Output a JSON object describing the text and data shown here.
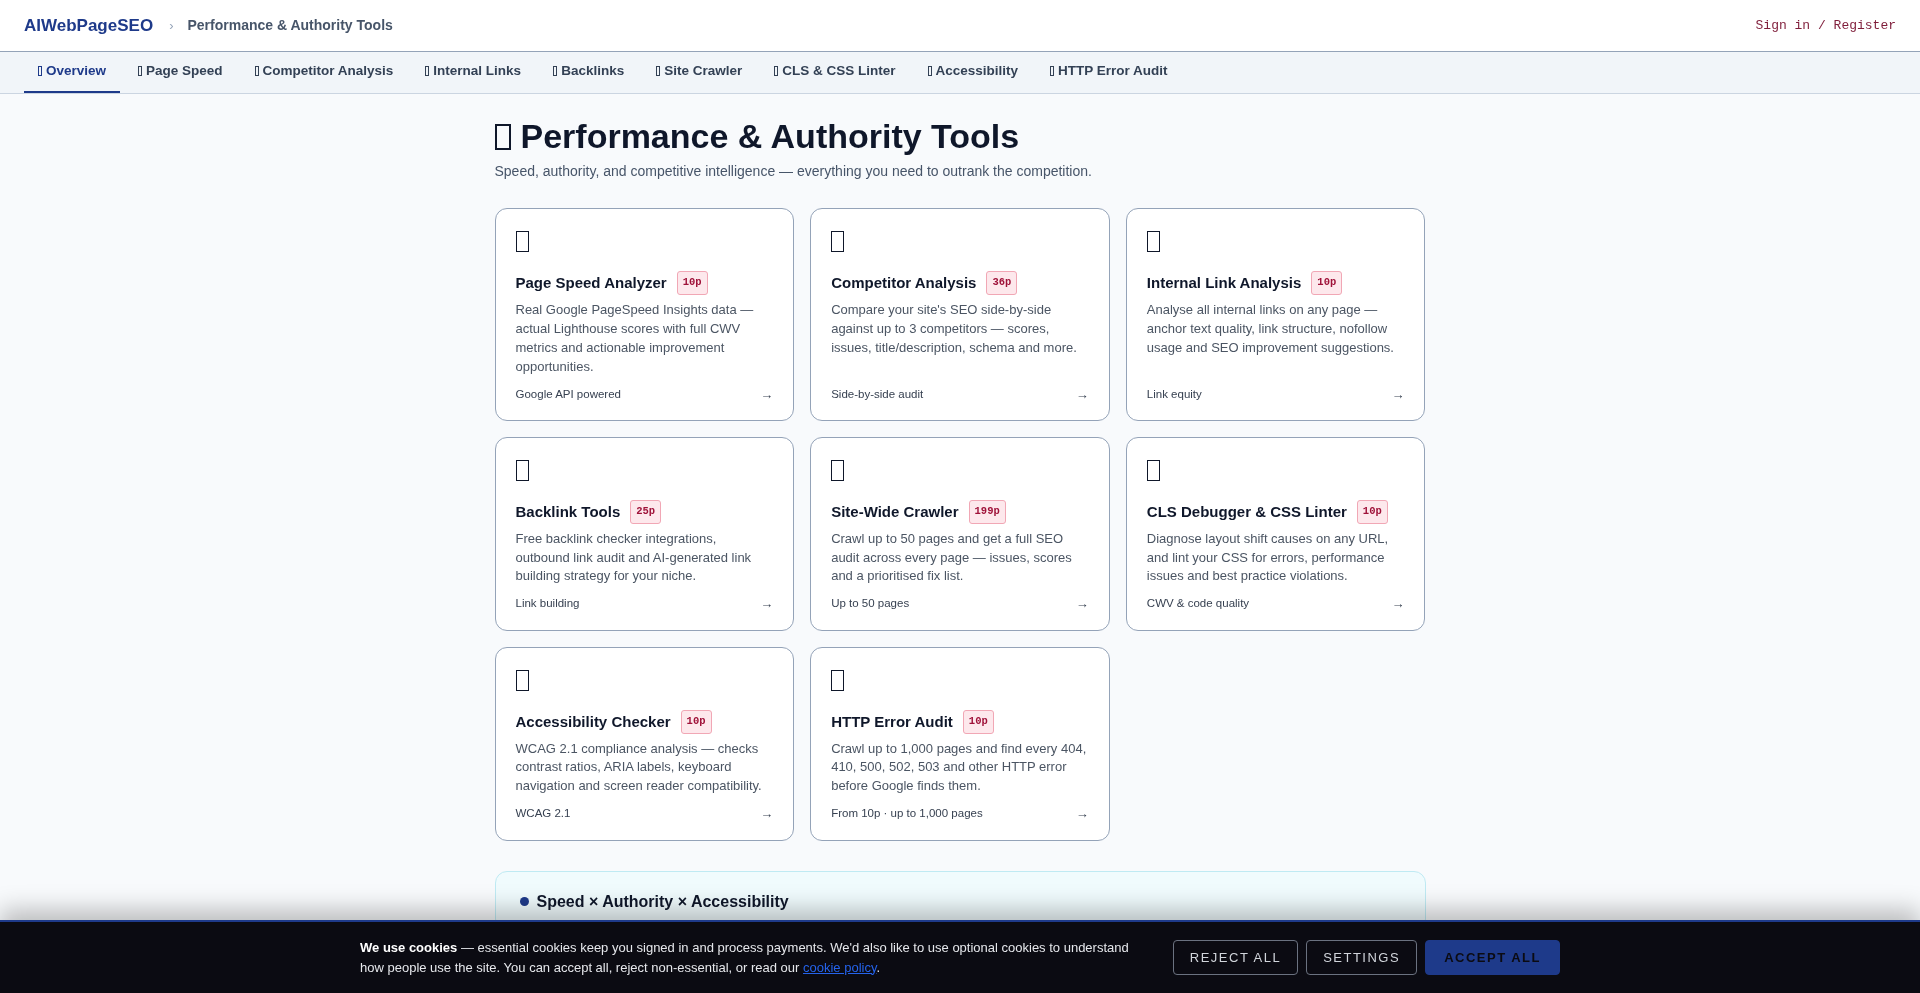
{
  "header": {
    "logo": "AIWebPageSEO",
    "separator": "›",
    "breadcrumb": "Performance & Authority Tools",
    "sign_in": "Sign in / Register"
  },
  "tabs": [
    {
      "label": "Overview",
      "selected": true
    },
    {
      "label": "Page Speed",
      "selected": false
    },
    {
      "label": "Competitor Analysis",
      "selected": false
    },
    {
      "label": "Internal Links",
      "selected": false
    },
    {
      "label": "Backlinks",
      "selected": false
    },
    {
      "label": "Site Crawler",
      "selected": false
    },
    {
      "label": "CLS & CSS Linter",
      "selected": false
    },
    {
      "label": "Accessibility",
      "selected": false
    },
    {
      "label": "HTTP Error Audit",
      "selected": false
    }
  ],
  "page": {
    "title": "Performance & Authority Tools",
    "subtitle": "Speed, authority, and competitive intelligence — everything you need to outrank the competition."
  },
  "tools": [
    {
      "name": "Page Speed Analyzer",
      "badge": "10p",
      "description": "Real Google PageSpeed Insights data — actual Lighthouse scores with full CWV metrics and actionable improvement opportunities.",
      "footer": "Google API powered",
      "arrow": "→"
    },
    {
      "name": "Competitor Analysis",
      "badge": "36p",
      "description": "Compare your site's SEO side-by-side against up to 3 competitors — scores, issues, title/description, schema and more.",
      "footer": "Side-by-side audit",
      "arrow": "→"
    },
    {
      "name": "Internal Link Analysis",
      "badge": "10p",
      "description": "Analyse all internal links on any page — anchor text quality, link structure, nofollow usage and SEO improvement suggestions.",
      "footer": "Link equity",
      "arrow": "→"
    },
    {
      "name": "Backlink Tools",
      "badge": "25p",
      "description": "Free backlink checker integrations, outbound link audit and AI-generated link building strategy for your niche.",
      "footer": "Link building",
      "arrow": "→"
    },
    {
      "name": "Site-Wide Crawler",
      "badge": "199p",
      "description": "Crawl up to 50 pages and get a full SEO audit across every page — issues, scores and a prioritised fix list.",
      "footer": "Up to 50 pages",
      "arrow": "→"
    },
    {
      "name": "CLS Debugger & CSS Linter",
      "badge": "10p",
      "description": "Diagnose layout shift causes on any URL, and lint your CSS for errors, performance issues and best practice violations.",
      "footer": "CWV & code quality",
      "arrow": "→"
    },
    {
      "name": "Accessibility Checker",
      "badge": "10p",
      "description": "WCAG 2.1 compliance analysis — checks contrast ratios, ARIA labels, keyboard navigation and screen reader compatibility.",
      "footer": "WCAG 2.1",
      "arrow": "→"
    },
    {
      "name": "HTTP Error Audit",
      "badge": "10p",
      "description": "Crawl up to 1,000 pages and find every 404, 410, 500, 502, 503 and other HTTP error before Google finds them.",
      "footer": "From 10p · up to 1,000 pages",
      "arrow": "→"
    }
  ],
  "info_panel": {
    "title": "Speed × Authority × Accessibility"
  },
  "cookie_banner": {
    "text": "**We use cookies** — essential cookies keep you signed in and process payments. We'd also like to use optional cookies to understand how people use the site. You can accept all, reject non-essential, or read our ",
    "link": "cookie policy",
    "end": ".",
    "buttons": [
      {
        "label": "REJECT ALL",
        "kind": "outline"
      },
      {
        "label": "SETTINGS",
        "kind": "outline"
      },
      {
        "label": "ACCEPT ALL",
        "kind": "primary"
      }
    ]
  }
}
